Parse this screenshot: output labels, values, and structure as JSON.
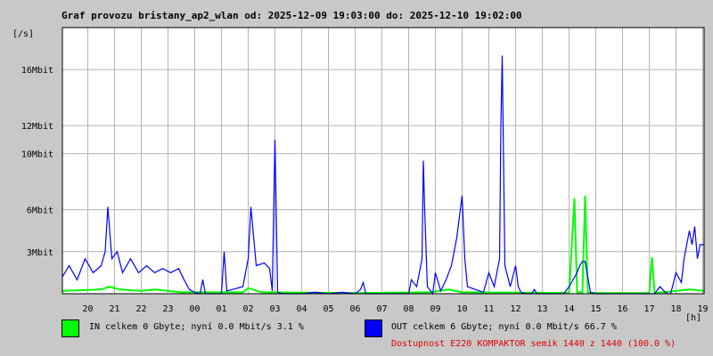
{
  "title": "Graf provozu bristany_ap2_wlan od: 2025-12-09 19:03:00 do: 2025-12-10 19:02:00",
  "colors": {
    "background": "#c8c8c8",
    "plot": "#ffffff",
    "grid": "#b4b4b4",
    "in": "#00ff00",
    "out": "#0000ff",
    "availability": "#e00000"
  },
  "legend": {
    "in_label": "IN celkem 0 Gbyte; nyní   0.0 Mbit/s 3.1 %",
    "out_label": "OUT celkem 6 Gbyte; nyní   0.0 Mbit/s 66.7 %",
    "availability": "Dostupnost E220 KOMPAKTOR semik 1440 z 1440 (100.0 %)"
  },
  "chart_data": {
    "type": "area",
    "ylabel": "[/s]",
    "xlabel": "[h]",
    "x_ticks": [
      "20",
      "21",
      "22",
      "23",
      "00",
      "01",
      "02",
      "03",
      "04",
      "05",
      "06",
      "07",
      "08",
      "09",
      "10",
      "11",
      "12",
      "13",
      "14",
      "15",
      "16",
      "17",
      "18",
      "19"
    ],
    "y_ticks": [
      {
        "label": "3Mbit",
        "value": 3
      },
      {
        "label": "6Mbit",
        "value": 6
      },
      {
        "label": "10Mbit",
        "value": 10
      },
      {
        "label": "12Mbit",
        "value": 12
      },
      {
        "label": "16Mbit",
        "value": 16
      }
    ],
    "ylim": [
      0,
      19
    ],
    "xlim": [
      19.05,
      43.05
    ],
    "grid": true,
    "series": [
      {
        "name": "IN",
        "color": "#00ff00",
        "x": [
          19.05,
          20.5,
          20.8,
          21.2,
          22.0,
          22.5,
          23.0,
          23.5,
          25.8,
          26.0,
          26.5,
          30.0,
          32.8,
          33.5,
          34.0,
          38.0,
          38.2,
          38.3,
          38.5,
          38.6,
          38.7,
          38.8,
          40.0,
          41.0,
          41.1,
          41.2,
          42.0,
          42.5,
          43.05
        ],
        "y": [
          0.2,
          0.3,
          0.5,
          0.3,
          0.2,
          0.3,
          0.2,
          0.1,
          0.1,
          0.4,
          0.1,
          0.05,
          0.1,
          0.3,
          0.1,
          0.05,
          6.8,
          0.1,
          0.1,
          7.0,
          0.1,
          0.05,
          0.05,
          0.05,
          2.6,
          0.05,
          0.2,
          0.3,
          0.2
        ]
      },
      {
        "name": "OUT",
        "color": "#0000ff",
        "x": [
          19.05,
          19.3,
          19.6,
          19.9,
          20.2,
          20.5,
          20.65,
          20.75,
          20.9,
          21.1,
          21.3,
          21.6,
          21.9,
          22.2,
          22.5,
          22.8,
          23.1,
          23.4,
          23.6,
          23.8,
          24.0,
          24.2,
          24.3,
          24.4,
          25.0,
          25.1,
          25.2,
          25.8,
          26.0,
          26.1,
          26.3,
          26.6,
          26.8,
          26.9,
          27.0,
          27.1,
          27.3,
          28.0,
          28.5,
          29.0,
          29.5,
          30.0,
          30.2,
          30.3,
          30.4,
          31.0,
          31.5,
          32.0,
          32.1,
          32.3,
          32.5,
          32.55,
          32.6,
          32.7,
          32.9,
          33.0,
          33.2,
          33.4,
          33.6,
          33.8,
          34.0,
          34.1,
          34.2,
          34.5,
          34.8,
          35.0,
          35.2,
          35.4,
          35.45,
          35.5,
          35.6,
          35.8,
          36.0,
          36.1,
          36.2,
          36.4,
          36.6,
          36.7,
          36.8,
          37.0,
          37.1,
          37.3,
          37.5,
          37.8,
          38.0,
          38.3,
          38.4,
          38.5,
          38.6,
          38.8,
          39.0,
          39.5,
          40.0,
          41.0,
          41.2,
          41.4,
          41.6,
          41.7,
          41.8,
          42.0,
          42.2,
          42.3,
          42.5,
          42.6,
          42.7,
          42.8,
          42.9,
          43.05
        ],
        "y": [
          1.2,
          2.0,
          1.0,
          2.5,
          1.5,
          2.0,
          3.0,
          6.2,
          2.5,
          3.0,
          1.5,
          2.5,
          1.5,
          2.0,
          1.5,
          1.8,
          1.5,
          1.8,
          1.0,
          0.3,
          0.1,
          0.0,
          1.0,
          0.0,
          0.0,
          3.0,
          0.2,
          0.5,
          2.5,
          6.2,
          2.0,
          2.2,
          1.8,
          0.2,
          11.0,
          0.1,
          0.0,
          0.0,
          0.1,
          0.0,
          0.1,
          0.0,
          0.3,
          0.8,
          0.0,
          0.0,
          0.0,
          0.0,
          1.0,
          0.5,
          2.5,
          9.5,
          6.0,
          0.5,
          0.0,
          1.5,
          0.2,
          1.0,
          2.0,
          4.0,
          7.0,
          2.5,
          0.5,
          0.3,
          0.1,
          1.5,
          0.5,
          2.5,
          12.0,
          17.0,
          2.0,
          0.5,
          2.0,
          0.5,
          0.1,
          0.0,
          0.0,
          0.3,
          0.0,
          0.0,
          0.0,
          0.0,
          0.0,
          0.0,
          0.5,
          1.5,
          2.0,
          2.3,
          2.3,
          0.1,
          0.0,
          0.0,
          0.0,
          0.0,
          0.0,
          0.5,
          0.1,
          0.0,
          0.0,
          1.5,
          0.8,
          2.5,
          4.5,
          3.5,
          4.8,
          2.5,
          3.5,
          3.5
        ]
      }
    ]
  }
}
